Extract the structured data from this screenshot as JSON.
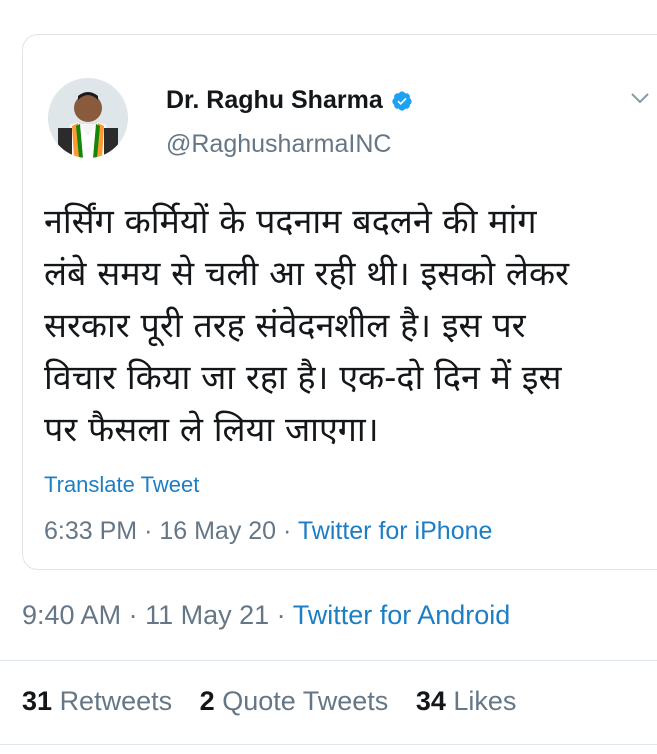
{
  "quoted_tweet": {
    "author": {
      "name": "Dr. Raghu Sharma",
      "handle": "@RaghusharmaINC",
      "verified_icon": "verified-badge-icon",
      "avatar": "profile-photo"
    },
    "menu_icon": "chevron-down-icon",
    "text": "नर्सिंग कर्मियों के पदनाम बदलने की मांग\nलंबे समय से चली आ रही थी। इसको लेकर\nसरकार पूरी तरह संवेदनशील है। इस पर\nविचार किया जा रहा है। एक-दो दिन में इस\nपर फैसला ले लिया जाएगा।",
    "translate_label": "Translate Tweet",
    "time": "6:33 PM",
    "date": "16 May 20",
    "source": "Twitter for iPhone"
  },
  "tweet": {
    "time": "9:40 AM",
    "date": "11 May 21",
    "source": "Twitter for Android"
  },
  "stats": {
    "retweets_count": "31",
    "retweets_label": "Retweets",
    "quote_tweets_count": "2",
    "quote_tweets_label": "Quote Tweets",
    "likes_count": "34",
    "likes_label": "Likes"
  },
  "colors": {
    "link": "#1d7ec4",
    "secondary_text": "#657786",
    "primary_text": "#14171a",
    "verified": "#1da1f2"
  }
}
